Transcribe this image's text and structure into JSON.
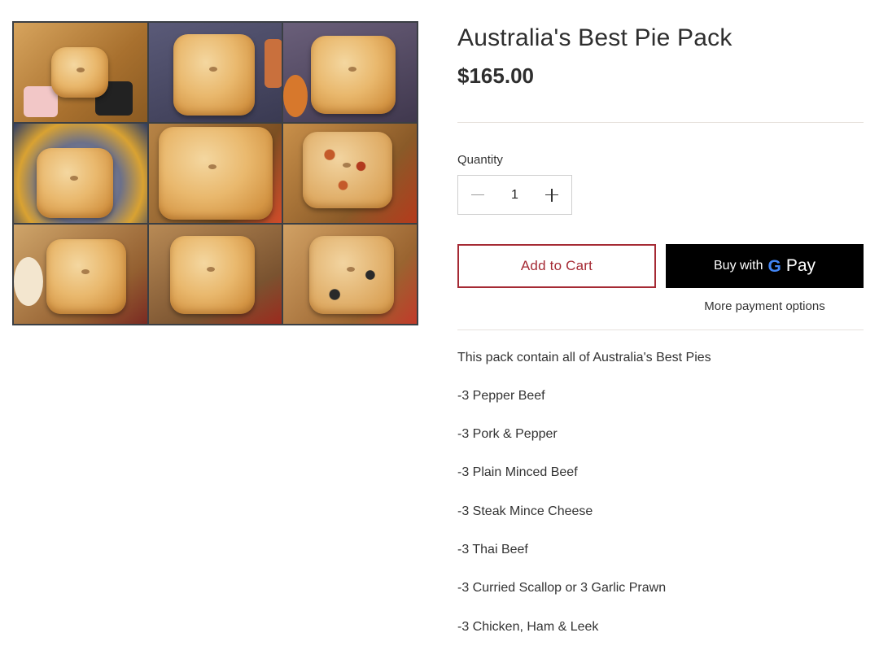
{
  "product": {
    "title": "Australia's Best Pie Pack",
    "price": "$165.00"
  },
  "quantity": {
    "label": "Quantity",
    "value": "1"
  },
  "actions": {
    "add_to_cart": "Add to Cart",
    "gpay_prefix": "Buy with",
    "gpay_brand_letter": "G",
    "gpay_suffix": "Pay",
    "more_payment_options": "More payment options"
  },
  "description": {
    "intro": "This pack contain all of Australia's Best Pies",
    "items": [
      "-3 Pepper Beef",
      "-3 Pork & Pepper",
      "-3 Plain Minced Beef",
      "-3 Steak Mince Cheese",
      "-3 Thai Beef",
      "-3 Curried Scallop or 3 Garlic Prawn",
      "-3 Chicken, Ham & Leek"
    ]
  },
  "colors": {
    "accent": "#a52a34",
    "gpay_button": "#000000",
    "google_blue": "#4285f4"
  }
}
